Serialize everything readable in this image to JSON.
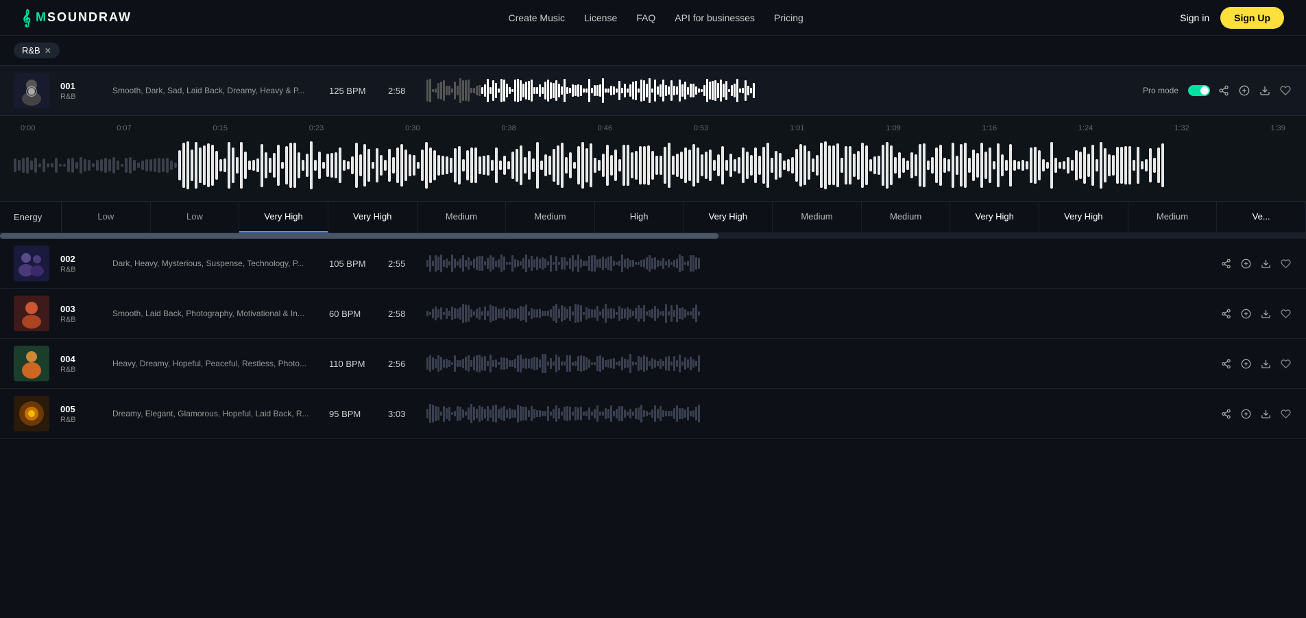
{
  "brand": {
    "logo_icon": "♪",
    "logo_name": "SOUNDRAW"
  },
  "nav": {
    "links": [
      {
        "label": "Create Music",
        "id": "create-music"
      },
      {
        "label": "License",
        "id": "license"
      },
      {
        "label": "FAQ",
        "id": "faq"
      },
      {
        "label": "API for businesses",
        "id": "api"
      },
      {
        "label": "Pricing",
        "id": "pricing"
      }
    ],
    "signin_label": "Sign in",
    "signup_label": "Sign Up"
  },
  "active_filter": {
    "tag": "R&B"
  },
  "active_track": {
    "num": "001",
    "genre": "R&B",
    "tags": "Smooth, Dark, Sad, Laid Back, Dreamy, Heavy & P...",
    "bpm": "125 BPM",
    "duration": "2:58",
    "pro_mode_label": "Pro mode"
  },
  "timeline": {
    "markers": [
      "0:00",
      "0:07",
      "0:15",
      "0:23",
      "0:30",
      "0:38",
      "0:46",
      "0:53",
      "1:01",
      "1:09",
      "1:16",
      "1:24",
      "1:32",
      "1:39"
    ]
  },
  "energy": {
    "label": "Energy",
    "cells": [
      {
        "level": "Low",
        "type": "low"
      },
      {
        "level": "Low",
        "type": "low"
      },
      {
        "level": "Very High",
        "type": "vh",
        "highlighted": true
      },
      {
        "level": "Very High",
        "type": "vh"
      },
      {
        "level": "Medium",
        "type": "med"
      },
      {
        "level": "Medium",
        "type": "med"
      },
      {
        "level": "High",
        "type": "high"
      },
      {
        "level": "Very High",
        "type": "vh"
      },
      {
        "level": "Medium",
        "type": "med"
      },
      {
        "level": "Medium",
        "type": "med"
      },
      {
        "level": "Very High",
        "type": "vh"
      },
      {
        "level": "Very High",
        "type": "vh"
      },
      {
        "level": "Medium",
        "type": "med"
      },
      {
        "level": "Ve...",
        "type": "vh"
      }
    ]
  },
  "tracks": [
    {
      "num": "002",
      "genre": "R&B",
      "tags": "Dark, Heavy, Mysterious, Suspense, Technology, P...",
      "bpm": "105 BPM",
      "duration": "2:55",
      "thumb_class": "thumb-color-1",
      "thumb_type": "people"
    },
    {
      "num": "003",
      "genre": "R&B",
      "tags": "Smooth, Laid Back, Photography, Motivational & In...",
      "bpm": "60 BPM",
      "duration": "2:58",
      "thumb_class": "thumb-color-2",
      "thumb_type": "person"
    },
    {
      "num": "004",
      "genre": "R&B",
      "tags": "Heavy, Dreamy, Hopeful, Peaceful, Restless, Photo...",
      "bpm": "110 BPM",
      "duration": "2:56",
      "thumb_class": "thumb-color-3",
      "thumb_type": "person"
    },
    {
      "num": "005",
      "genre": "R&B",
      "tags": "Dreamy, Elegant, Glamorous, Hopeful, Laid Back, R...",
      "bpm": "95 BPM",
      "duration": "3:03",
      "thumb_class": "thumb-color-4",
      "thumb_type": "glow"
    }
  ]
}
